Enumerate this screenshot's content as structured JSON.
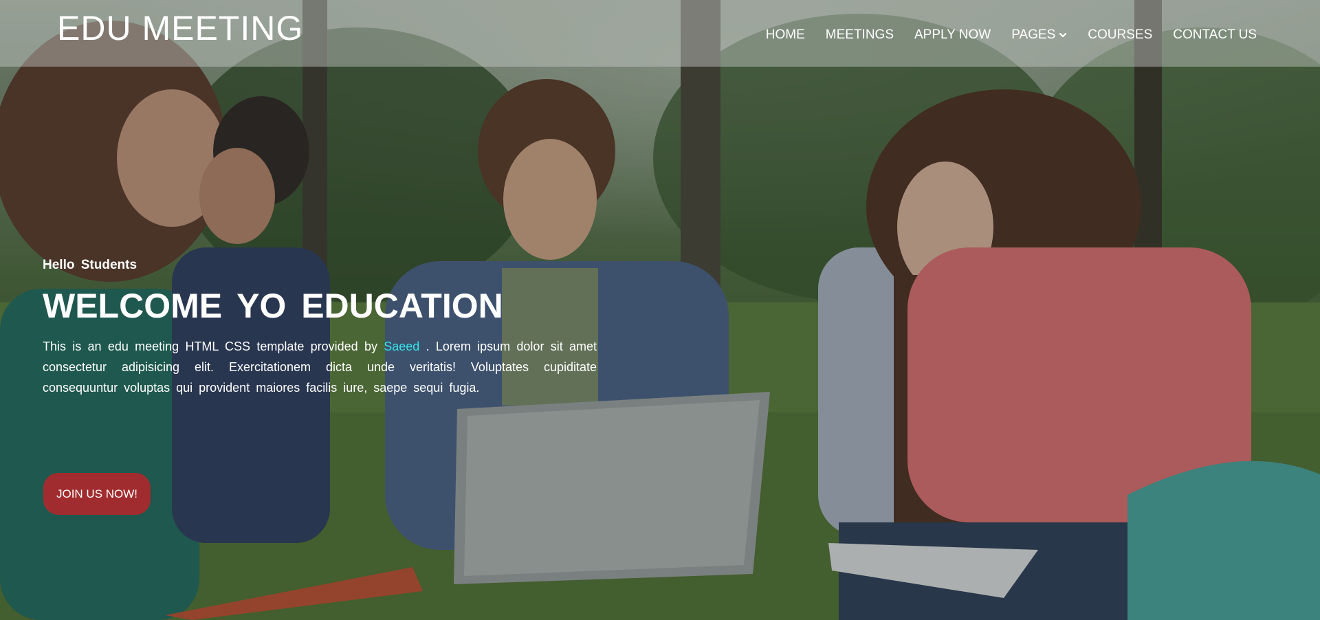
{
  "header": {
    "logo": "EDU MEETING",
    "nav": [
      {
        "label": "HOME"
      },
      {
        "label": "MEETINGS"
      },
      {
        "label": "APPLY NOW"
      },
      {
        "label": "PAGES"
      },
      {
        "label": "COURSES"
      },
      {
        "label": "CONTACT US"
      }
    ]
  },
  "hero": {
    "kicker": "Hello Students",
    "title": "WELCOME YO EDUCATION",
    "desc_before": "This is an edu meeting HTML CSS template provided by ",
    "desc_link": "Saeed",
    "desc_after": " . Lorem ipsum dolor sit amet consectetur adipisicing elit. Exercitationem dicta unde veritatis! Voluptates cupiditate consequuntur voluptas qui provident maiores facilis iure, saepe sequi fugia.",
    "cta": "JOIN US NOW!"
  },
  "colors": {
    "cta": "#a12c2f",
    "link": "#34e4ea"
  },
  "icons": {
    "pages_dropdown": "chevron-down-icon"
  }
}
